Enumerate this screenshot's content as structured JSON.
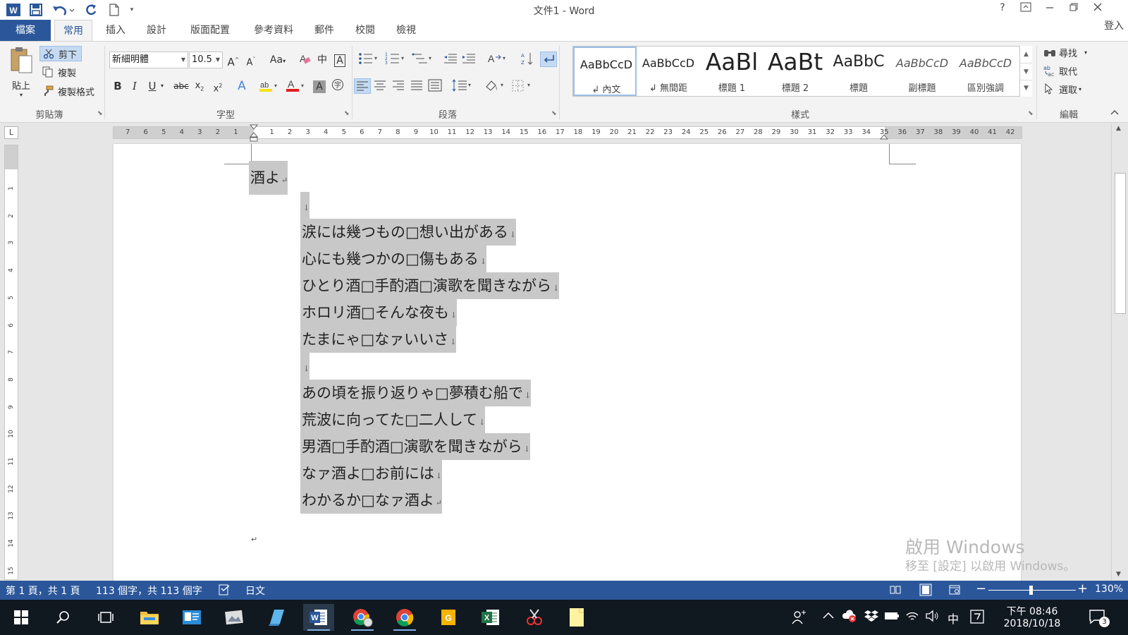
{
  "window": {
    "title": "文件1 - Word",
    "help": "?",
    "sign_in": "登入"
  },
  "tabs": [
    "檔案",
    "常用",
    "插入",
    "設計",
    "版面配置",
    "參考資料",
    "郵件",
    "校閱",
    "檢視"
  ],
  "ribbon": {
    "clipboard": {
      "label": "剪貼簿",
      "paste": "貼上",
      "cut": "剪下",
      "copy": "複製",
      "format_painter": "複製格式"
    },
    "font": {
      "label": "字型",
      "name": "新細明體",
      "size": "10.5"
    },
    "paragraph": {
      "label": "段落"
    },
    "styles": {
      "label": "樣式",
      "items": [
        {
          "sample": "AaBbCcD",
          "name": "↲ 內文"
        },
        {
          "sample": "AaBbCcD",
          "name": "↲ 無間距"
        },
        {
          "sample": "AaBl",
          "name": "標題 1"
        },
        {
          "sample": "AaBt",
          "name": "標題 2"
        },
        {
          "sample": "AaBbC",
          "name": "標題"
        },
        {
          "sample": "AaBbCcD",
          "name": "副標題"
        },
        {
          "sample": "AaBbCcD",
          "name": "區別強調"
        }
      ]
    },
    "editing": {
      "label": "編輯",
      "find": "尋找",
      "replace": "取代",
      "select": "選取"
    }
  },
  "ruler": {
    "corner": "L",
    "left_numbers": [
      "7",
      "6",
      "5",
      "4",
      "3",
      "2",
      "1"
    ],
    "right_numbers": [
      "1",
      "2",
      "3",
      "4",
      "5",
      "6",
      "7",
      "8",
      "9",
      "10",
      "11",
      "12",
      "13",
      "14",
      "15",
      "16",
      "17",
      "18",
      "19",
      "20",
      "21",
      "22",
      "23",
      "24",
      "25",
      "26",
      "27",
      "28",
      "29",
      "30",
      "31",
      "32",
      "33",
      "34",
      "35",
      "36",
      "37",
      "38",
      "39",
      "40",
      "41",
      "42"
    ],
    "vertical_numbers": [
      "1",
      "2",
      "3",
      "4",
      "5",
      "6",
      "7",
      "8",
      "9",
      "10",
      "11",
      "12",
      "13",
      "14",
      "15"
    ]
  },
  "document": {
    "lines": [
      "酒よ",
      "",
      "涙には幾つもの□想い出がある",
      "心にも幾つかの□傷もある",
      "ひとり酒□手酌酒□演歌を聞きながら",
      "ホロリ酒□そんな夜も",
      "たまにゃ□なァいいさ",
      "",
      "あの頃を振り返りゃ□夢積む船で",
      "荒波に向ってた□二人して",
      "男酒□手酌酒□演歌を聞きながら",
      "なァ酒よ□お前には",
      "わかるか□なァ酒よ"
    ],
    "paragraph_mark": "↵",
    "line_break_mark": "↓"
  },
  "watermark": {
    "line1": "啟用 Windows",
    "line2": "移至 [設定] 以啟用 Windows。"
  },
  "status": {
    "page": "第 1 頁，共 1 頁",
    "words": "113 個字，共 113 個字",
    "language": "日文",
    "zoom": "130%"
  },
  "taskbar": {
    "ime": "中",
    "time": "下午 08:46",
    "date": "2018/10/18",
    "notifications": "3"
  },
  "colors": {
    "accent": "#2b579a",
    "selection": "#c8c8c8",
    "taskbar": "#101820"
  }
}
